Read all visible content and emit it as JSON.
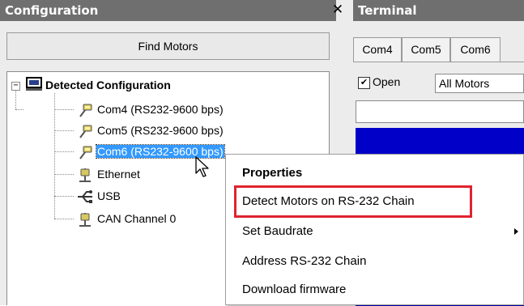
{
  "configuration": {
    "title": "Configuration",
    "close_glyph": "✕",
    "find_motors_label": "Find Motors",
    "tree": {
      "expander": "−",
      "root_label": "Detected Configuration",
      "root_icon": "computer-icon",
      "items": [
        {
          "label": "Com4 (RS232-9600 bps)",
          "icon": "serial-port-icon",
          "selected": false
        },
        {
          "label": "Com5 (RS232-9600 bps)",
          "icon": "serial-port-icon",
          "selected": false
        },
        {
          "label": "Com6 (RS232-9600 bps)",
          "icon": "serial-port-icon",
          "selected": true
        },
        {
          "label": "Ethernet",
          "icon": "ethernet-icon",
          "selected": false
        },
        {
          "label": "USB",
          "icon": "usb-icon",
          "selected": false
        },
        {
          "label": "CAN Channel 0",
          "icon": "can-icon",
          "selected": false
        }
      ]
    }
  },
  "terminal": {
    "title": "Terminal",
    "tabs": [
      "Com4",
      "Com5",
      "Com6"
    ],
    "open_label": "Open",
    "open_checked": true,
    "check_glyph": "✔",
    "motor_select_value": "All Motors",
    "output_color": "#0000c8"
  },
  "context_menu": {
    "items": [
      {
        "label": "Properties",
        "bold": true,
        "has_submenu": false
      },
      {
        "label": "Detect Motors on RS-232 Chain",
        "bold": false,
        "has_submenu": false,
        "highlighted": true
      },
      {
        "label": "Set Baudrate",
        "bold": false,
        "has_submenu": true
      },
      {
        "label": "Address RS-232 Chain",
        "bold": false,
        "has_submenu": false
      },
      {
        "label": "Download firmware",
        "bold": false,
        "has_submenu": false
      }
    ],
    "highlight_color": "#e0232f"
  },
  "colors": {
    "titlebar": "#6f6f6f",
    "selection": "#3399ff",
    "panel_bg": "#ececec"
  }
}
